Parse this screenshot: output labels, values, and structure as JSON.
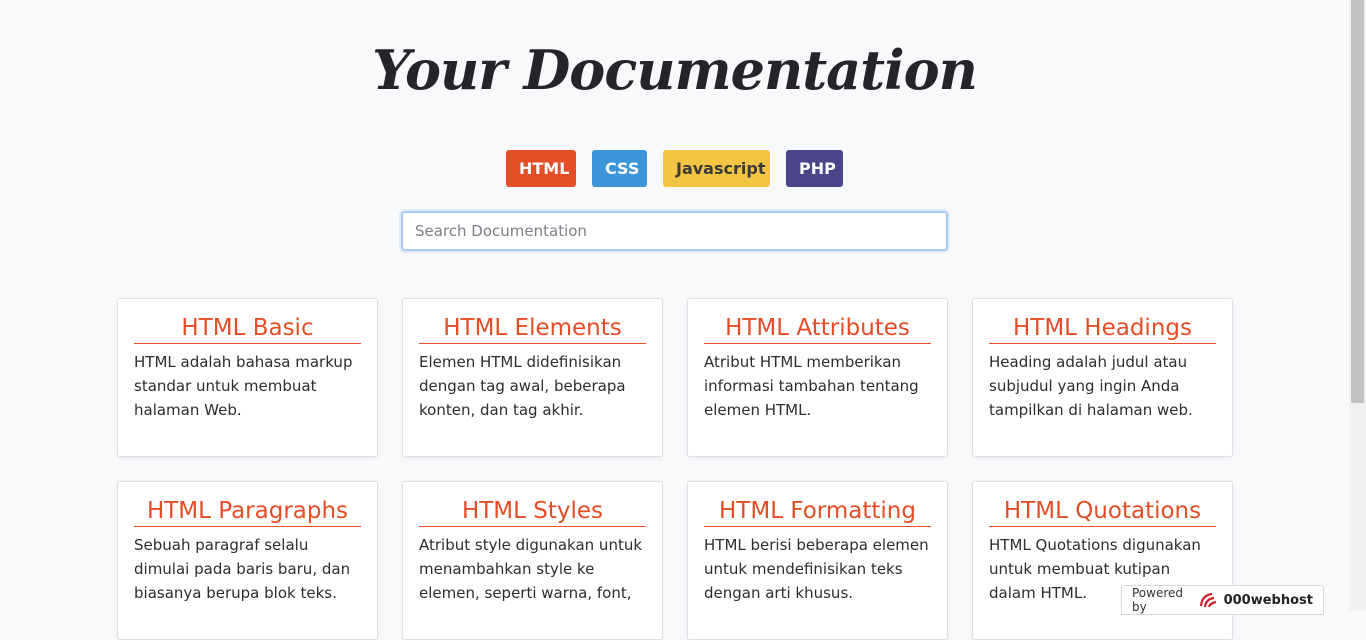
{
  "header": {
    "title": "Your Documentation"
  },
  "languages": {
    "html": "HTML",
    "css": "CSS",
    "js": "Javascript",
    "php": "PHP"
  },
  "search": {
    "placeholder": "Search Documentation",
    "value": ""
  },
  "cards": [
    {
      "title": "HTML Basic",
      "text": "HTML adalah bahasa markup standar untuk membuat halaman Web."
    },
    {
      "title": "HTML Elements",
      "text": "Elemen HTML didefinisikan dengan tag awal, beberapa konten, dan tag akhir."
    },
    {
      "title": "HTML Attributes",
      "text": "Atribut HTML memberikan informasi tambahan tentang elemen HTML."
    },
    {
      "title": "HTML Headings",
      "text": "Heading adalah judul atau subjudul yang ingin Anda tampilkan di halaman web."
    },
    {
      "title": "HTML Paragraphs",
      "text": "Sebuah paragraf selalu dimulai pada baris baru, dan biasanya berupa blok teks."
    },
    {
      "title": "HTML Styles",
      "text": "Atribut style digunakan untuk menambahkan style ke elemen, seperti warna, font,"
    },
    {
      "title": "HTML Formatting",
      "text": "HTML berisi beberapa elemen untuk mendefinisikan teks dengan arti khusus."
    },
    {
      "title": "HTML Quotations",
      "text": "HTML Quotations digunakan untuk membuat kutipan dalam HTML."
    }
  ],
  "footer_badge": {
    "prefix": "Powered by",
    "brand": "000webhost"
  },
  "colors": {
    "html": "#e44d26",
    "css": "#3c95d8",
    "javascript": "#f4c542",
    "php": "#4a4689"
  }
}
